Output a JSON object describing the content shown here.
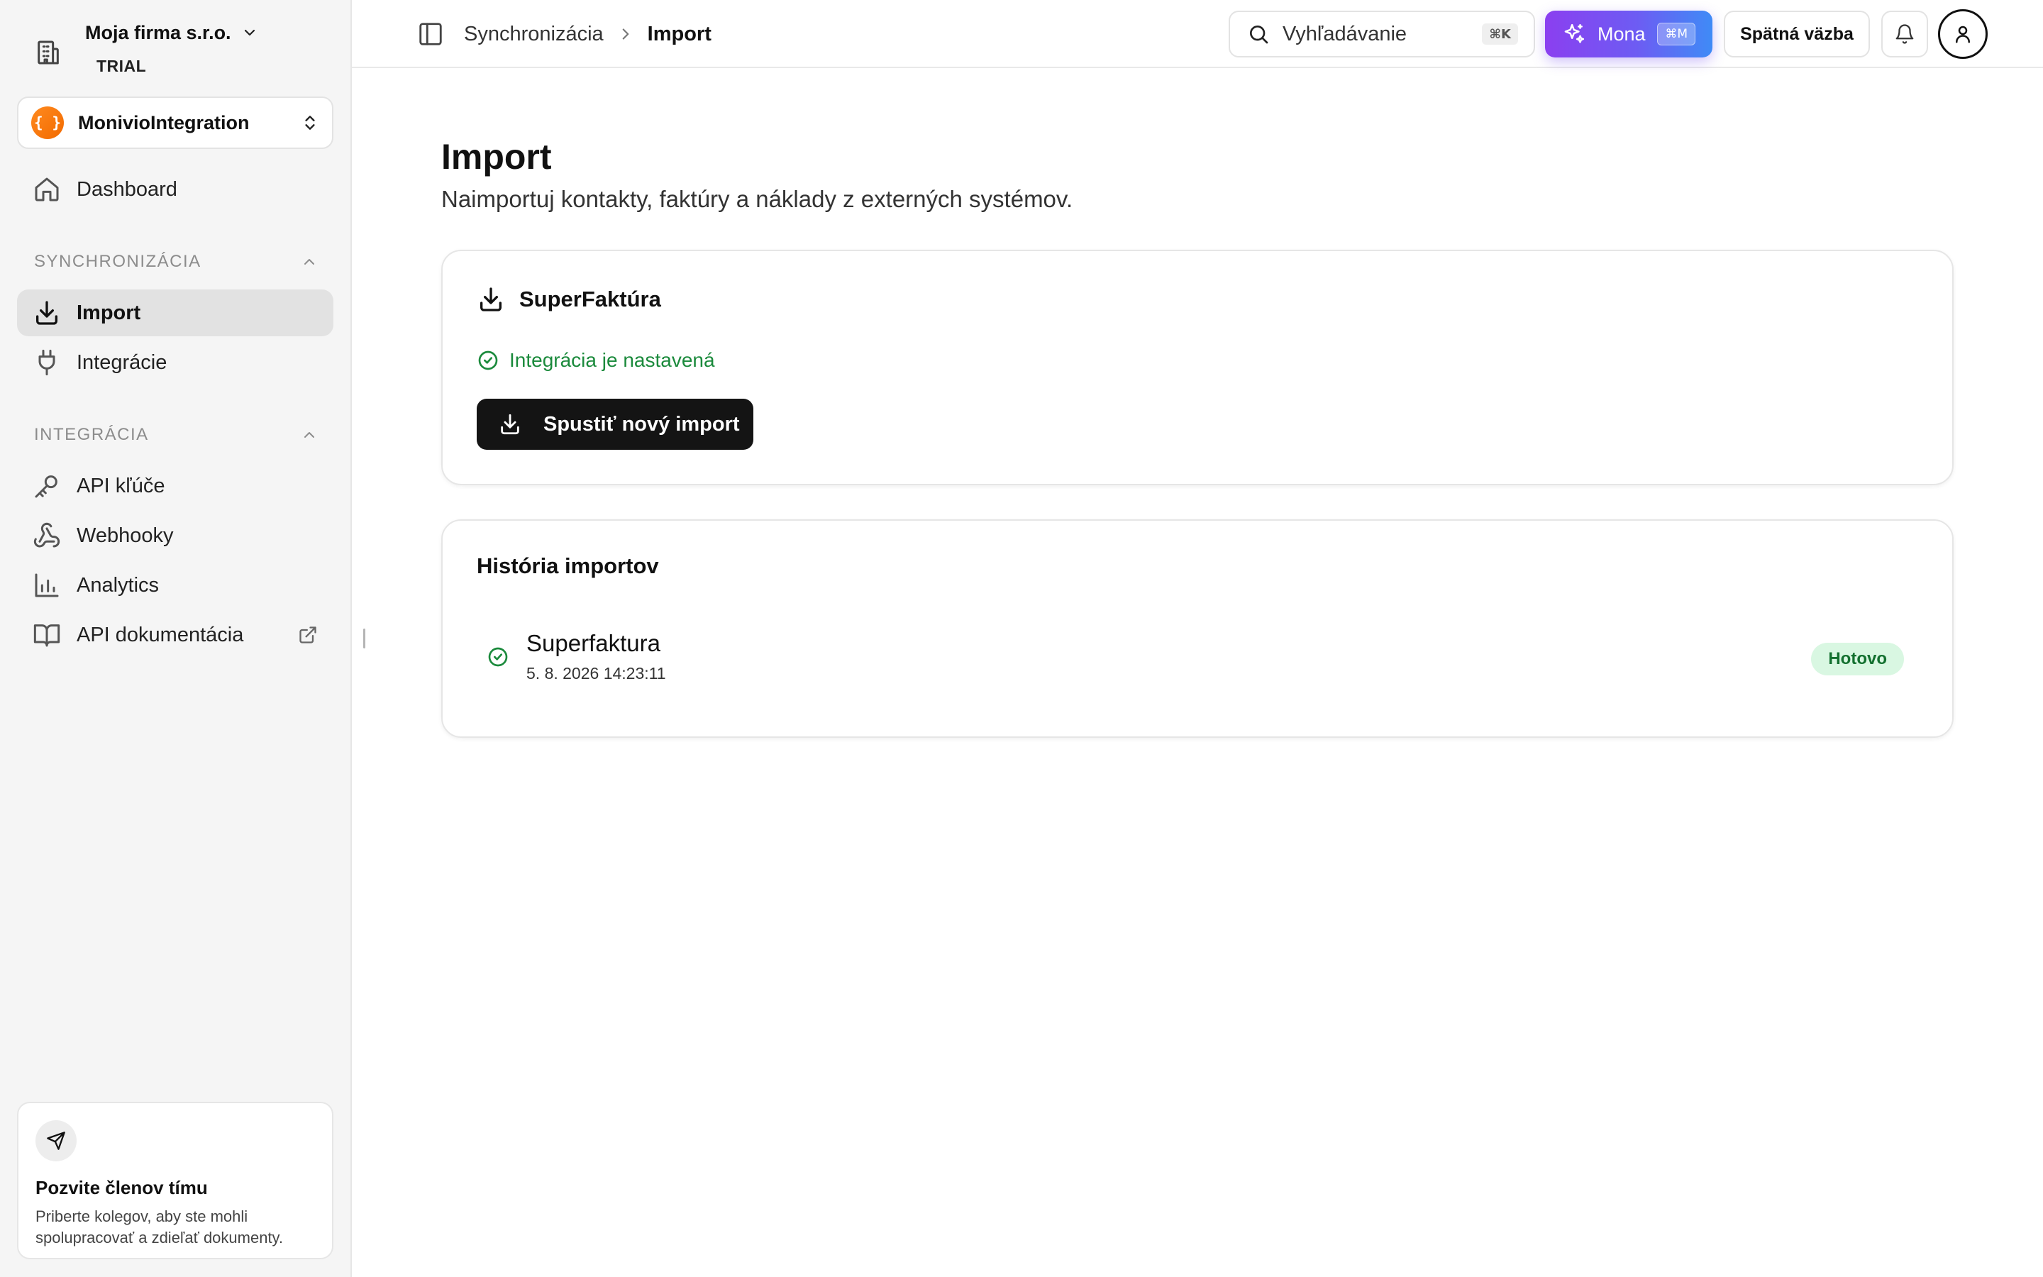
{
  "company": {
    "name": "Moja firma s.r.o.",
    "plan": "TRIAL"
  },
  "org": {
    "logo_text": "{ }",
    "name": "MonivioIntegration"
  },
  "sidebar": {
    "dashboard": "Dashboard",
    "sections": [
      {
        "label": "SYNCHRONIZÁCIA",
        "items": [
          "Import",
          "Integrácie"
        ]
      },
      {
        "label": "INTEGRÁCIA",
        "items": [
          "API kľúče",
          "Webhooky",
          "Analytics",
          "API dokumentácia"
        ]
      }
    ],
    "active_item": "Import"
  },
  "invite": {
    "title": "Pozvite členov tímu",
    "desc_line1": "Priberte kolegov, aby ste mohli",
    "desc_line2": "spolupracovať a zdieľať dokumenty."
  },
  "topbar": {
    "breadcrumb": [
      "Synchronizácia",
      "Import"
    ],
    "search_placeholder": "Vyhľadávanie",
    "search_shortcut": "⌘K",
    "mona_label": "Mona",
    "mona_shortcut": "⌘M",
    "feedback_label": "Spätná väzba"
  },
  "page": {
    "title": "Import",
    "subtitle": "Naimportuj kontakty, faktúry a náklady z externých systémov."
  },
  "integration_card": {
    "title": "SuperFaktúra",
    "status": "Integrácia je nastavená",
    "button": "Spustiť nový import"
  },
  "history": {
    "title": "História importov",
    "rows": [
      {
        "name": "Superfaktura",
        "datetime": "5. 8. 2026 14:23:11",
        "status": "Hotovo"
      }
    ]
  },
  "colors": {
    "success": "#1b8a3c",
    "badge_bg": "#d9f7e2",
    "mona_gradient_start": "#8b3ff0",
    "mona_gradient_end": "#3f8bf6",
    "org_logo": "#f26a00"
  },
  "icons": {
    "company": "building-icon",
    "dashboard": "home-icon",
    "import": "download-icon",
    "integrations": "plug-icon",
    "api_keys": "key-icon",
    "webhooks": "webhook-icon",
    "analytics": "bar-chart-icon",
    "api_docs": "book-icon",
    "external": "external-link-icon",
    "invite": "send-icon",
    "search": "search-icon",
    "mona": "sparkles-icon",
    "notifications": "bell-icon",
    "account": "user-icon"
  }
}
